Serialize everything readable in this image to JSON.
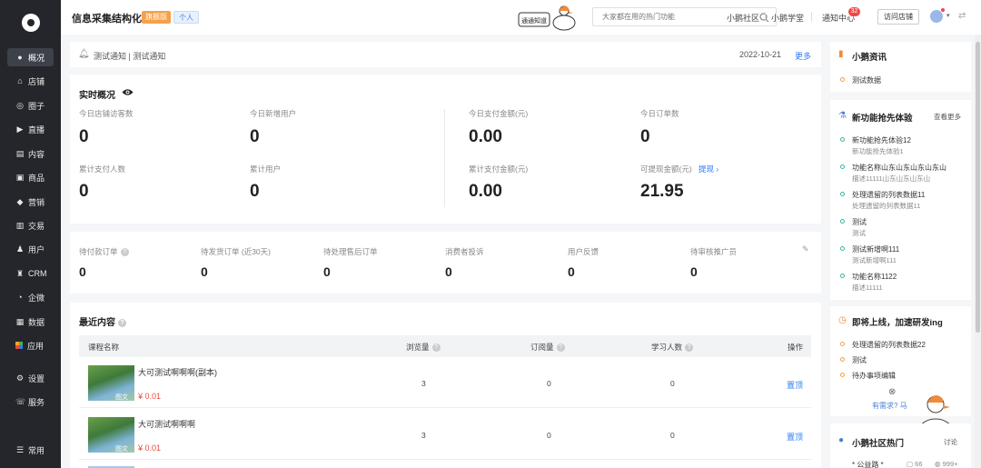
{
  "sidebar": {
    "items": [
      {
        "label": "概况",
        "icon": "●"
      },
      {
        "label": "店铺",
        "icon": "⌂"
      },
      {
        "label": "圈子",
        "icon": "◎"
      },
      {
        "label": "直播",
        "icon": "▶"
      },
      {
        "label": "内容",
        "icon": "▤"
      },
      {
        "label": "商品",
        "icon": "▣"
      },
      {
        "label": "营销",
        "icon": "◆"
      },
      {
        "label": "交易",
        "icon": "▥"
      },
      {
        "label": "用户",
        "icon": "♟"
      },
      {
        "label": "CRM",
        "icon": "♜"
      },
      {
        "label": "企微",
        "icon": "◔"
      },
      {
        "label": "数据",
        "icon": "▦"
      },
      {
        "label": "应用",
        "icon": ""
      },
      {
        "label": "设置",
        "icon": "⚙"
      },
      {
        "label": "服务",
        "icon": "☏"
      }
    ],
    "bottom": {
      "label": "常用",
      "icon": "☰"
    }
  },
  "header": {
    "title": "信息采集结构化",
    "badge_edition": "旗舰版",
    "badge_type": "个人",
    "banner_text": "通通知道",
    "search_placeholder": "大家都在用的热门功能",
    "links": {
      "community": "小鹅社区",
      "academy": "小鹅学堂",
      "notice": "通知中心"
    },
    "notice_count": "32",
    "store_button": "访问店铺"
  },
  "notice": {
    "text": "测试通知 | 测试通知",
    "date": "2022-10-21",
    "more": "更多"
  },
  "realtime": {
    "title": "实时概况",
    "stats": [
      {
        "label": "今日店铺访客数",
        "value": "0"
      },
      {
        "label": "今日新增用户",
        "value": "0"
      },
      {
        "label": "今日支付金额(元)",
        "value": "0.00"
      },
      {
        "label": "今日订单数",
        "value": "0"
      },
      {
        "label": "累计支付人数",
        "value": "0"
      },
      {
        "label": "累计用户",
        "value": "0"
      },
      {
        "label": "累计支付金额(元)",
        "value": "0.00"
      },
      {
        "label": "可提现金额(元)",
        "value": "21.95",
        "link": "提现 ›"
      }
    ]
  },
  "orders": [
    {
      "label": "待付款订单",
      "value": "0"
    },
    {
      "label": "待发货订单 (近30天)",
      "value": "0"
    },
    {
      "label": "待处理售后订单",
      "value": "0"
    },
    {
      "label": "消费者投诉",
      "value": "0"
    },
    {
      "label": "用户反馈",
      "value": "0"
    },
    {
      "label": "待审核推广员",
      "value": "0"
    }
  ],
  "recent": {
    "title": "最近内容",
    "columns": {
      "name": "课程名称",
      "views": "浏览量",
      "subs": "订阅量",
      "learners": "学习人数",
      "ops": "操作"
    },
    "rows": [
      {
        "name": "大可测试啊啊啊(副本)",
        "tag": "图文",
        "price": "¥ 0.01",
        "views": "3",
        "subs": "0",
        "learners": "0",
        "op": "置顶"
      },
      {
        "name": "大可测试啊啊啊",
        "tag": "图文",
        "price": "¥ 0.01",
        "views": "3",
        "subs": "0",
        "learners": "0",
        "op": "置顶"
      }
    ]
  },
  "right": {
    "news": {
      "title": "小鹅资讯",
      "items": [
        "测试数据"
      ]
    },
    "beta": {
      "title": "新功能抢先体验",
      "more": "查看更多",
      "items": [
        {
          "title": "新功能抢先体验12",
          "sub": "新功能抢先体验1"
        },
        {
          "title": "功能名称山东山东山东山东山",
          "sub": "描述11111山东山东山东山"
        },
        {
          "title": "处理遗留的列表数据11",
          "sub": "处理遗留的列表数据11"
        },
        {
          "title": "测试",
          "sub": "测试"
        },
        {
          "title": "测试新增啊111",
          "sub": "测试新增啊111"
        },
        {
          "title": "功能名称1122",
          "sub": "描述11111"
        }
      ]
    },
    "upcoming": {
      "title": "即将上线，加速研发ing",
      "items": [
        "处理遗留的列表数据22",
        "测试",
        "待办事项编辑"
      ],
      "need_text": "有需求? 马"
    },
    "community": {
      "title": "小鹅社区热门",
      "tail": "讨论",
      "item": "* 公益路 *",
      "stat1": "66",
      "stat2": "999+"
    }
  },
  "colors": {
    "sidebar_bg": "#25262b",
    "accent_blue": "#2d7cf6",
    "price_red": "#e64b3c",
    "badge_orange": "#f5a14a"
  }
}
